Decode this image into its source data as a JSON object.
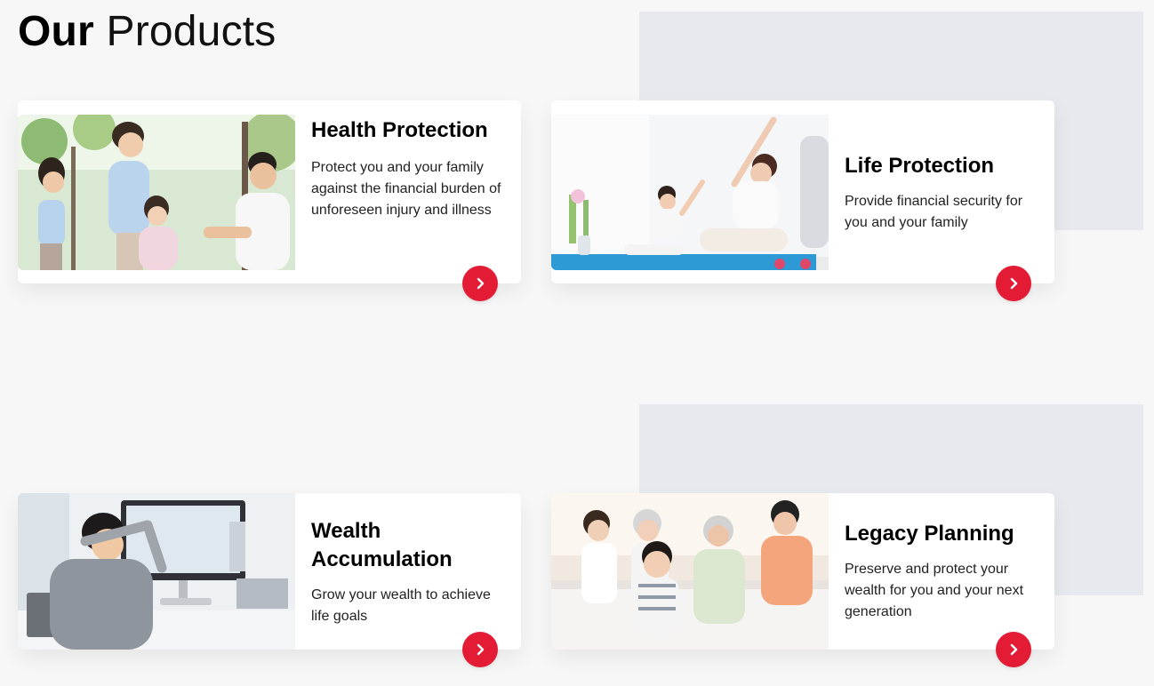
{
  "heading": {
    "strong": "Our",
    "light": "Products"
  },
  "products": [
    {
      "title": "Health Protection",
      "description": "Protect you and your family against the financial burden of unforeseen injury and illness",
      "image": "family-outdoor-photo",
      "action_icon": "chevron-right-icon"
    },
    {
      "title": "Life Protection",
      "description": "Provide financial security for you and your family",
      "image": "mother-daughter-yoga-photo",
      "action_icon": "chevron-right-icon"
    },
    {
      "title": "Wealth Accumulation",
      "description": "Grow your wealth to achieve life goals",
      "image": "relaxed-man-at-desk-photo",
      "action_icon": "chevron-right-icon"
    },
    {
      "title": "Legacy Planning",
      "description": "Preserve and protect your wealth for you and your next generation",
      "image": "multi-generation-family-photo",
      "action_icon": "chevron-right-icon"
    }
  ],
  "colors": {
    "accent": "#e31b35",
    "page_background": "#f7f7f7",
    "panel_background": "#e6eaee",
    "card_background": "#ffffff"
  }
}
